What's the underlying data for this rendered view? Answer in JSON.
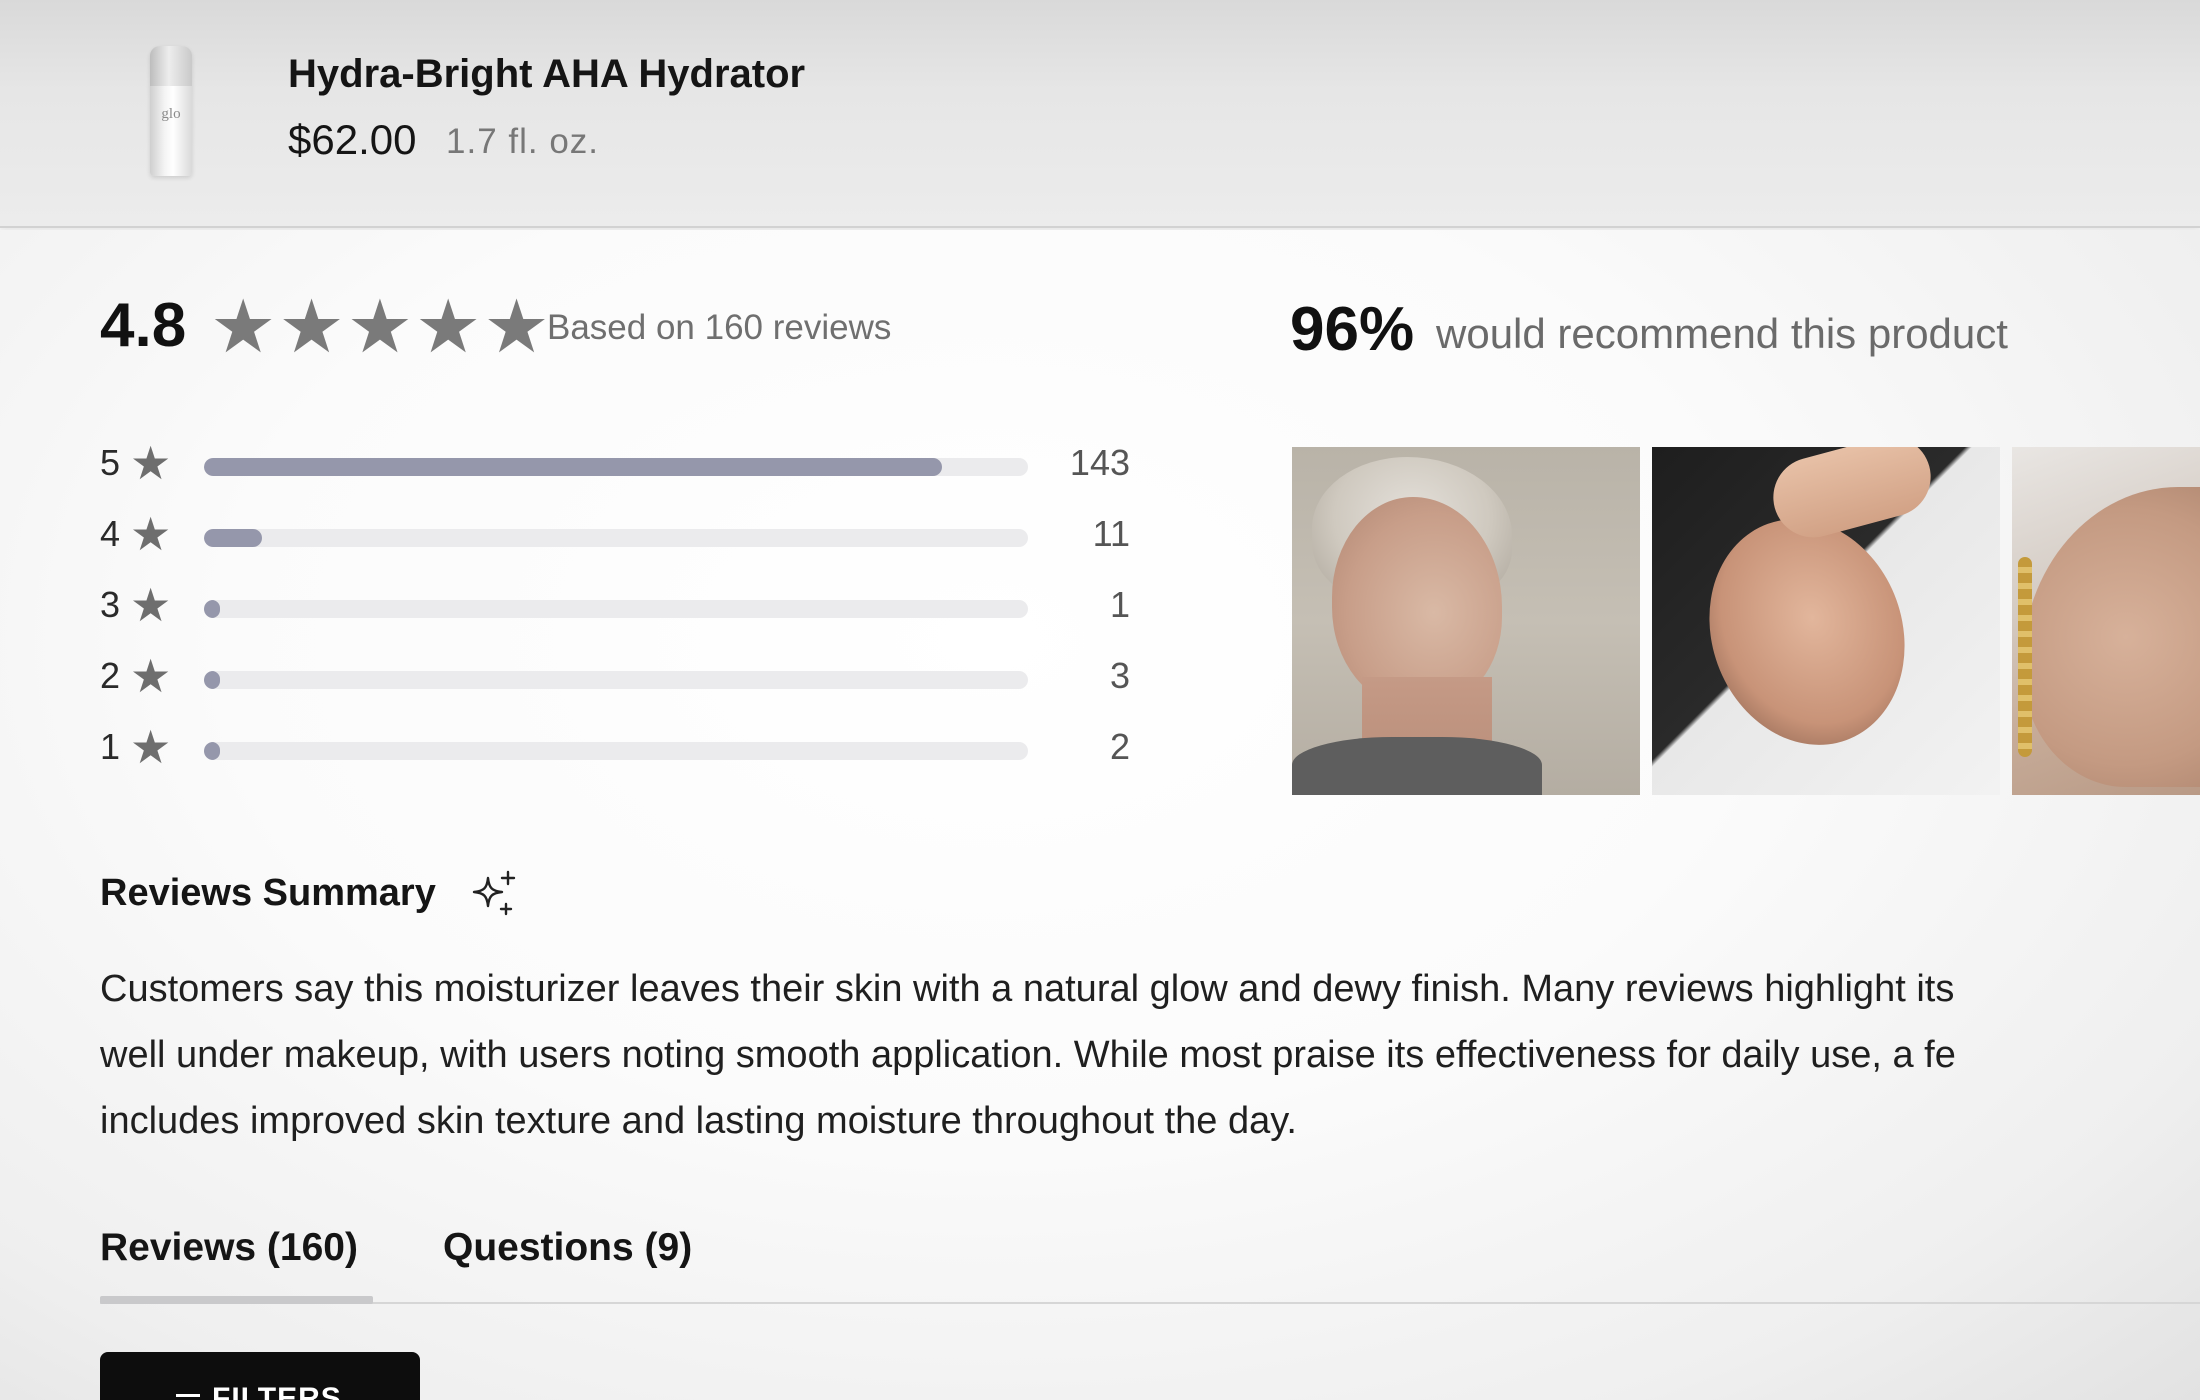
{
  "product": {
    "title": "Hydra-Bright AHA Hydrator",
    "price": "$62.00",
    "size": "1.7 fl. oz.",
    "thumb_brand": "glo"
  },
  "rating": {
    "average": "4.8",
    "stars": 5,
    "based_on": "Based on 160 reviews"
  },
  "recommend": {
    "percent": "96%",
    "text": "would recommend this product"
  },
  "histogram": [
    {
      "label": "5",
      "count": "143",
      "fraction": 0.896
    },
    {
      "label": "4",
      "count": "11",
      "fraction": 0.07
    },
    {
      "label": "3",
      "count": "1",
      "fraction": 0.02
    },
    {
      "label": "2",
      "count": "3",
      "fraction": 0.02
    },
    {
      "label": "1",
      "count": "2",
      "fraction": 0.02
    }
  ],
  "summary": {
    "heading": "Reviews Summary",
    "icon": "sparkle-icon",
    "lines": [
      "Customers say this moisturizer leaves their skin with a natural glow and dewy finish. Many reviews highlight its",
      "well under makeup, with users noting smooth application. While most praise its effectiveness for daily use, a fe",
      "includes improved skin texture and lasting moisture throughout the day."
    ]
  },
  "tabs": [
    {
      "label": "Reviews (160)",
      "active": true
    },
    {
      "label": "Questions (9)",
      "active": false
    }
  ],
  "filters_button": {
    "label": "FILTERS",
    "icon": "filter-icon"
  },
  "colors": {
    "star": "#7a7a7a",
    "bar_fill": "#9597ab",
    "bar_track": "#ebebed",
    "button_bg": "#0d0d0d"
  }
}
